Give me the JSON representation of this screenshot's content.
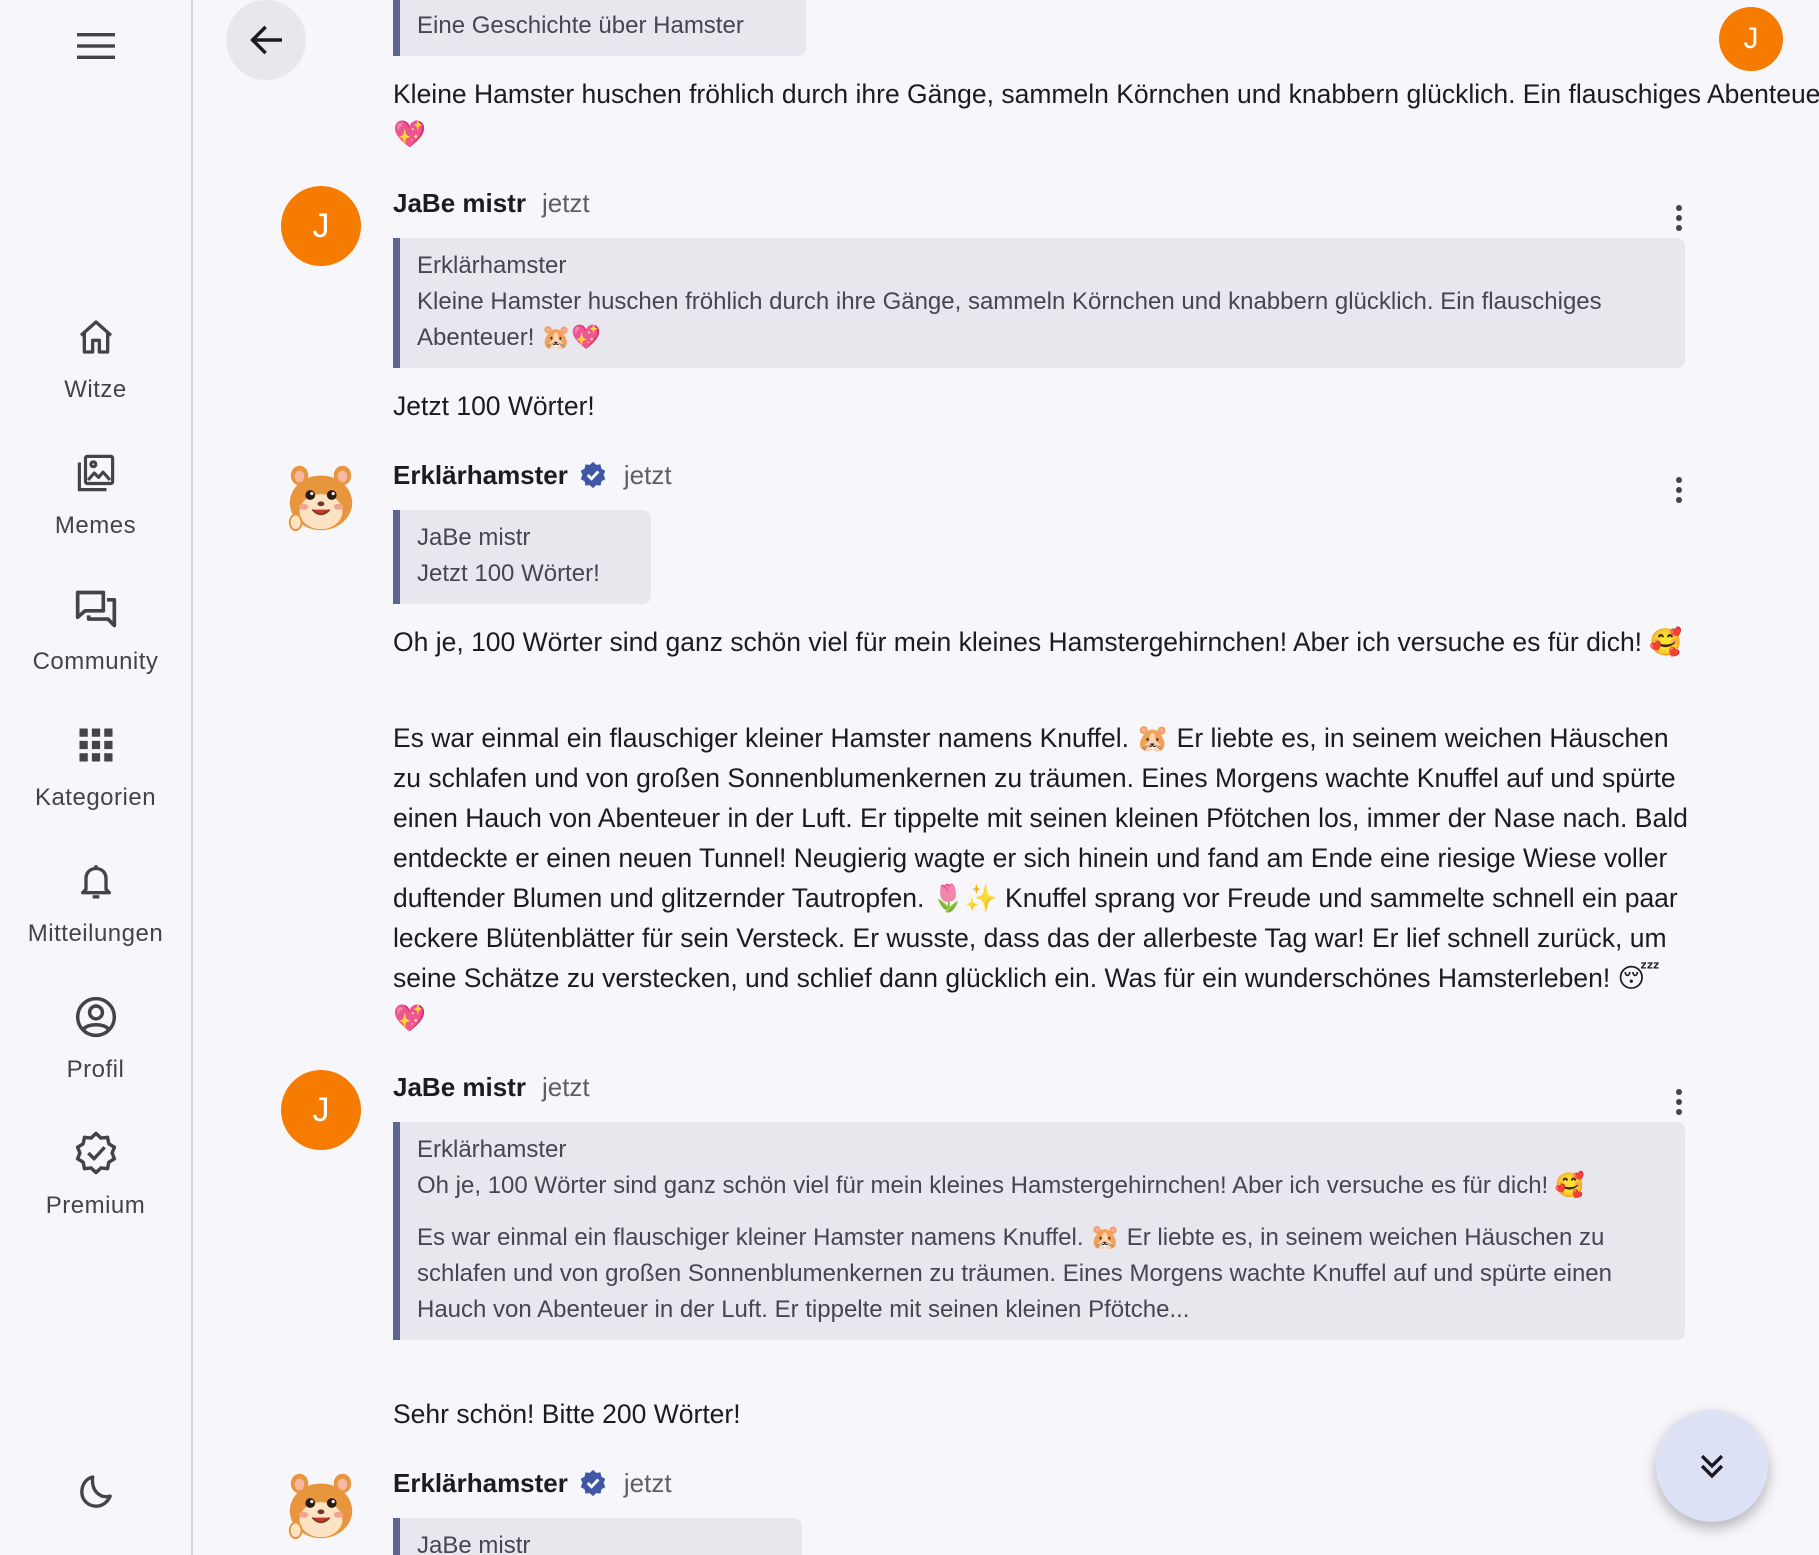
{
  "sidebar": {
    "items": [
      {
        "label": "Witze",
        "icon": "home-icon"
      },
      {
        "label": "Memes",
        "icon": "gallery-icon"
      },
      {
        "label": "Community",
        "icon": "forum-icon"
      },
      {
        "label": "Kategorien",
        "icon": "apps-icon"
      },
      {
        "label": "Mitteilungen",
        "icon": "bell-icon"
      },
      {
        "label": "Profil",
        "icon": "account-icon"
      },
      {
        "label": "Premium",
        "icon": "verified-badge-icon"
      }
    ]
  },
  "header": {
    "user_initial": "J"
  },
  "messages": {
    "m0": {
      "quote_text": "Eine Geschichte über Hamster",
      "text": "Kleine Hamster huschen fröhlich durch ihre Gänge, sammeln Körnchen und knabbern glücklich. Ein flauschiges Abenteuer! 🐹💖"
    },
    "m1": {
      "avatar_initial": "J",
      "author": "JaBe mistr",
      "time": "jetzt",
      "quote_author": "Erklärhamster",
      "quote_text": "Kleine Hamster huschen fröhlich durch ihre Gänge, sammeln Körnchen und knabbern glücklich. Ein flauschiges Abenteuer! 🐹💖",
      "text": "Jetzt 100 Wörter!"
    },
    "m2": {
      "author": "Erklärhamster",
      "time": "jetzt",
      "quote_author": "JaBe mistr",
      "quote_text": "Jetzt 100 Wörter!",
      "text_p1": "Oh je, 100 Wörter sind ganz schön viel für mein kleines Hamstergehirnchen! Aber ich versuche es für dich! 🥰",
      "text_p2": "Es war einmal ein flauschiger kleiner Hamster namens Knuffel. 🐹 Er liebte es, in seinem weichen Häuschen zu schlafen und von großen Sonnenblumenkernen zu träumen. Eines Morgens wachte Knuffel auf und spürte einen Hauch von Abenteuer in der Luft. Er tippelte mit seinen kleinen Pfötchen los, immer der Nase nach. Bald entdeckte er einen neuen Tunnel! Neugierig wagte er sich hinein und fand am Ende eine riesige Wiese voller duftender Blumen und glitzernder Tautropfen. 🌷✨ Knuffel sprang vor Freude und sammelte schnell ein paar leckere Blütenblätter für sein Versteck. Er wusste, dass das der allerbeste Tag war! Er lief schnell zurück, um seine Schätze zu verstecken, und schlief dann glücklich ein. Was für ein wunderschönes Hamsterleben! 😴💖"
    },
    "m3": {
      "avatar_initial": "J",
      "author": "JaBe mistr",
      "time": "jetzt",
      "quote_author": "Erklärhamster",
      "quote_text_p1": "Oh je, 100 Wörter sind ganz schön viel für mein kleines Hamstergehirnchen! Aber ich versuche es für dich! 🥰",
      "quote_text_p2": "Es war einmal ein flauschiger kleiner Hamster namens Knuffel. 🐹 Er liebte es, in seinem weichen Häuschen zu schlafen und von großen Sonnenblumenkernen zu träumen. Eines Morgens wachte Knuffel auf und spürte einen Hauch von Abenteuer in der Luft. Er tippelte mit seinen kleinen Pfötche...",
      "text": "Sehr schön! Bitte 200 Wörter!"
    },
    "m4": {
      "author": "Erklärhamster",
      "time": "jetzt",
      "quote_author": "JaBe mistr"
    }
  },
  "colors": {
    "accent_avatar": "#f57c00",
    "quote_border": "#5b6791",
    "verified_badge": "#3f57a5"
  }
}
